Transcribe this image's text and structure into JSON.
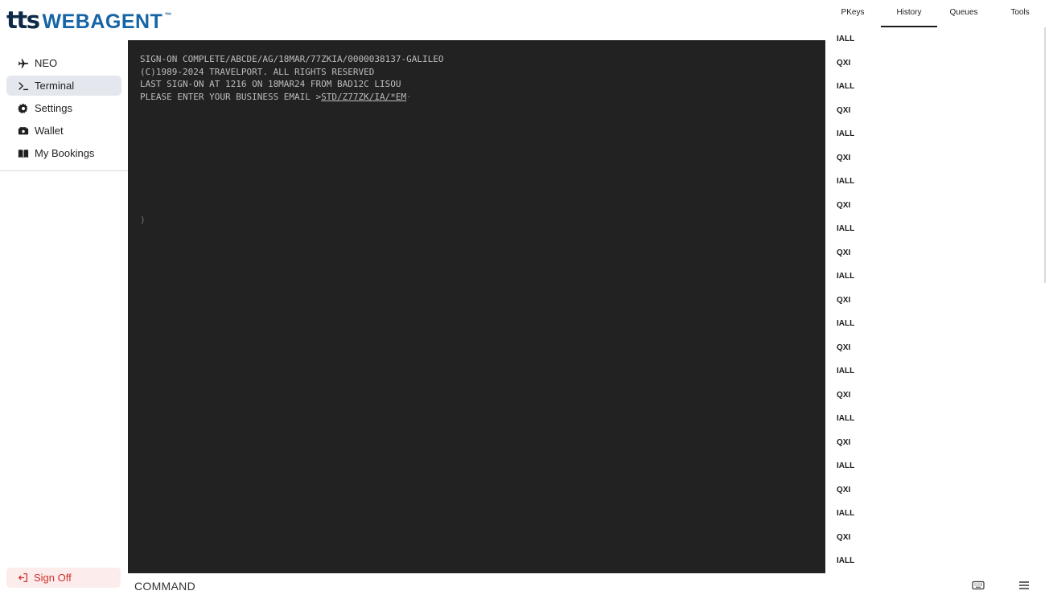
{
  "logo": {
    "tts": "tts",
    "webagent": "WEBAGENT",
    "tm": "™"
  },
  "sidebar": {
    "items": [
      {
        "label": "NEO",
        "icon": "airplane-icon"
      },
      {
        "label": "Terminal",
        "icon": "terminal-prompt-icon",
        "active": true
      },
      {
        "label": "Settings",
        "icon": "gear-icon"
      },
      {
        "label": "Wallet",
        "icon": "wallet-icon"
      },
      {
        "label": "My Bookings",
        "icon": "book-icon"
      }
    ],
    "signoff": {
      "label": "Sign Off",
      "icon": "sign-out-icon"
    }
  },
  "terminal": {
    "lines": [
      "SIGN-ON COMPLETE/ABCDE/AG/18MAR/77ZKIA/0000038137-GALILEO",
      "(C)1989-2024 TRAVELPORT. ALL RIGHTS RESERVED",
      "LAST SIGN-ON AT 1216 ON 18MAR24 FROM BAD12C LISOU"
    ],
    "prompt_prefix": "PLEASE ENTER YOUR BUSINESS EMAIL >",
    "prompt_link": "STD/Z77ZK/IA/*EM",
    "prompt_suffix": "·",
    "paren": ")"
  },
  "command": {
    "label": "COMMAND"
  },
  "tabs": [
    {
      "label": "PKeys"
    },
    {
      "label": "History",
      "active": true
    },
    {
      "label": "Queues"
    },
    {
      "label": "Tools"
    }
  ],
  "history": [
    "IALL",
    "QXI",
    "IALL",
    "QXI",
    "IALL",
    "QXI",
    "IALL",
    "QXI",
    "IALL",
    "QXI",
    "IALL",
    "QXI",
    "IALL",
    "QXI",
    "IALL",
    "QXI",
    "IALL",
    "QXI",
    "IALL",
    "QXI",
    "IALL",
    "QXI",
    "IALL"
  ],
  "footer": {
    "icons": [
      "keyboard-icon",
      "menu-icon"
    ]
  },
  "colors": {
    "brand_dark": "#0e2a47",
    "brand_blue": "#1565a6",
    "terminal_bg": "#222222",
    "signoff_red": "#d0312d"
  }
}
